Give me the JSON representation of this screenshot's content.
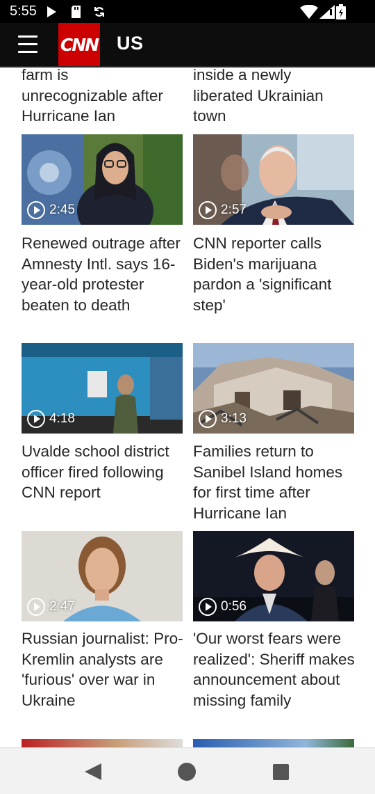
{
  "status": {
    "time": "5:55"
  },
  "app_bar": {
    "logo": "CNN",
    "section": "US"
  },
  "top_partial": {
    "left": "farm is\nunrecognizable after\nHurricane Ian",
    "right": "inside a newly\nliberated Ukrainian\ntown"
  },
  "cards": [
    {
      "duration": "2:45",
      "headline": "Renewed outrage after Amnesty Intl. says 16-year-old protester beaten to death"
    },
    {
      "duration": "2:57",
      "headline": "CNN reporter calls Biden's marijuana pardon a 'significant step'"
    },
    {
      "duration": "4:18",
      "headline": "Uvalde school district officer fired following CNN report"
    },
    {
      "duration": "3:13",
      "headline": "Families return to Sanibel Island homes for first time after Hurricane Ian"
    },
    {
      "duration": "2:47",
      "headline": "Russian journalist: Pro-Kremlin analysts are 'furious' over war in Ukraine"
    },
    {
      "duration": "0:56",
      "headline": "'Our worst fears were realized': Sheriff makes announcement about missing family"
    }
  ],
  "nav": {
    "icons": [
      "back-icon",
      "home-icon",
      "recents-icon"
    ]
  }
}
